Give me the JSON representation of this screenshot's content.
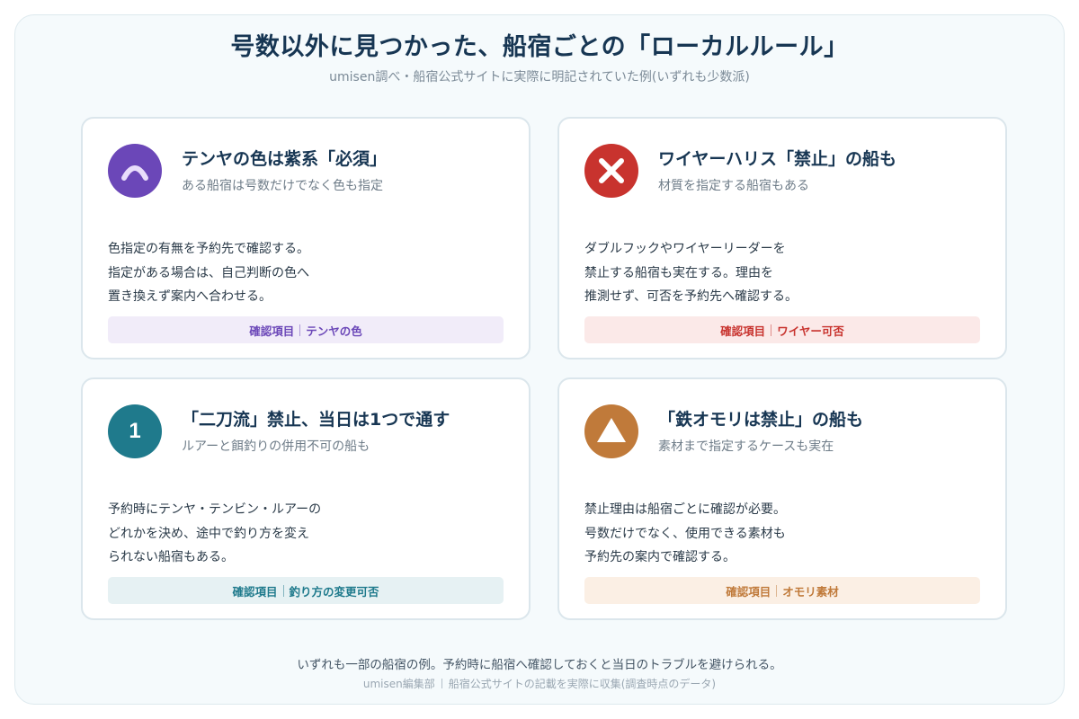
{
  "header": {
    "title": "号数以外に見つかった、船宿ごとの「ローカルルール」",
    "subtitle": "umisen調べ・船宿公式サイトに実際に明記されていた例(いずれも少数派)"
  },
  "cards": [
    {
      "accent": "#6b47b8",
      "tag_bg": "#f1ecf9",
      "icon": "arch-icon",
      "title": "テンヤの色は紫系「必須」",
      "subtitle": "ある船宿は号数だけでなく色も指定",
      "body": [
        "色指定の有無を予約先で確認する。",
        "指定がある場合は、自己判断の色へ",
        "置き換えず案内へ合わせる。"
      ],
      "tag_label": "確認項目",
      "tag_value": "テンヤの色"
    },
    {
      "accent": "#c8332e",
      "tag_bg": "#fbe9e8",
      "icon": "cross-icon",
      "title": "ワイヤーハリス「禁止」の船も",
      "subtitle": "材質を指定する船宿もある",
      "body": [
        "ダブルフックやワイヤーリーダーを",
        "禁止する船宿も実在する。理由を",
        "推測せず、可否を予約先へ確認する。"
      ],
      "tag_label": "確認項目",
      "tag_value": "ワイヤー可否"
    },
    {
      "accent": "#1f7a8c",
      "tag_bg": "#e6f1f3",
      "icon": "number-one-icon",
      "icon_text": "1",
      "title": "「二刀流」禁止、当日は1つで通す",
      "subtitle": "ルアーと餌釣りの併用不可の船も",
      "body": [
        "予約時にテンヤ・テンビン・ルアーの",
        "どれかを決め、途中で釣り方を変え",
        "られない船宿もある。"
      ],
      "tag_label": "確認項目",
      "tag_value": "釣り方の変更可否"
    },
    {
      "accent": "#c07a3a",
      "tag_bg": "#fbefe4",
      "icon": "triangle-icon",
      "title": "「鉄オモリは禁止」の船も",
      "subtitle": "素材まで指定するケースも実在",
      "body": [
        "禁止理由は船宿ごとに確認が必要。",
        "号数だけでなく、使用できる素材も",
        "予約先の案内で確認する。"
      ],
      "tag_label": "確認項目",
      "tag_value": "オモリ素材"
    }
  ],
  "footer": {
    "note": "いずれも一部の船宿の例。予約時に船宿へ確認しておくと当日のトラブルを避けられる。",
    "credit_left": "umisen編集部",
    "credit_right": "船宿公式サイトの記載を実際に収集(調査時点のデータ)"
  }
}
